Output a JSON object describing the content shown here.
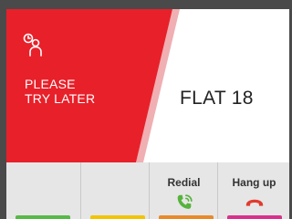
{
  "status": {
    "icon": "clock-person-icon",
    "line1": "PLEASE",
    "line2": "TRY LATER",
    "color": "#e8202a"
  },
  "flat": {
    "label": "FLAT 18"
  },
  "actions": {
    "col1": {
      "label": "",
      "strip_color": "#57b947"
    },
    "col2": {
      "label": "",
      "strip_color": "#f3c400"
    },
    "col3": {
      "label": "Redial",
      "icon": "phone-redial-icon",
      "icon_color": "#56b33d",
      "strip_color": "#e98a2a"
    },
    "col4": {
      "label": "Hang up",
      "icon": "phone-hangup-icon",
      "icon_color": "#e13b2f",
      "strip_color": "#d9308d"
    }
  }
}
